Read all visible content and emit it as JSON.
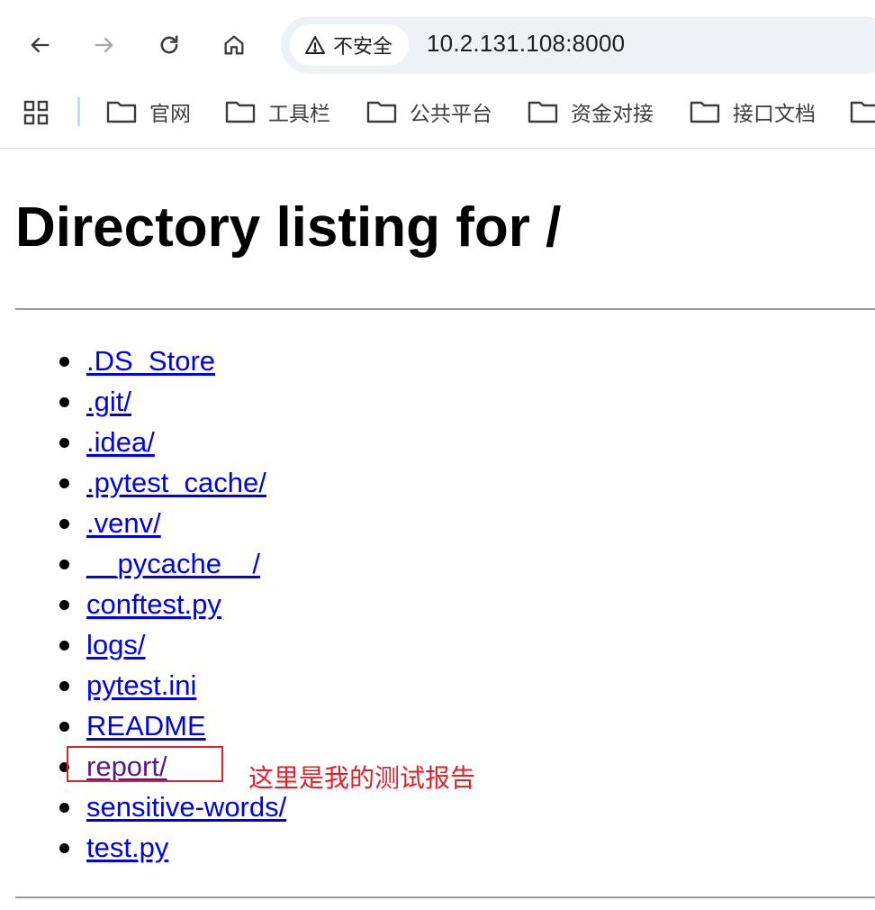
{
  "browser": {
    "security_label": "不安全",
    "url": "10.2.131.108:8000",
    "bookmarks": [
      "官网",
      "工具栏",
      "公共平台",
      "资金对接",
      "接口文档"
    ]
  },
  "page": {
    "title": "Directory listing for /",
    "entries": [
      ".DS_Store",
      ".git/",
      ".idea/",
      ".pytest_cache/",
      ".venv/",
      "__pycache__/",
      "conftest.py",
      "logs/",
      "pytest.ini",
      "README",
      "report/",
      "sensitive-words/",
      "test.py"
    ]
  },
  "annotation": {
    "text": "这里是我的测试报告",
    "color": "#e0202a"
  },
  "colors": {
    "link": "#0000ee",
    "visited_link": "#551a8b"
  }
}
